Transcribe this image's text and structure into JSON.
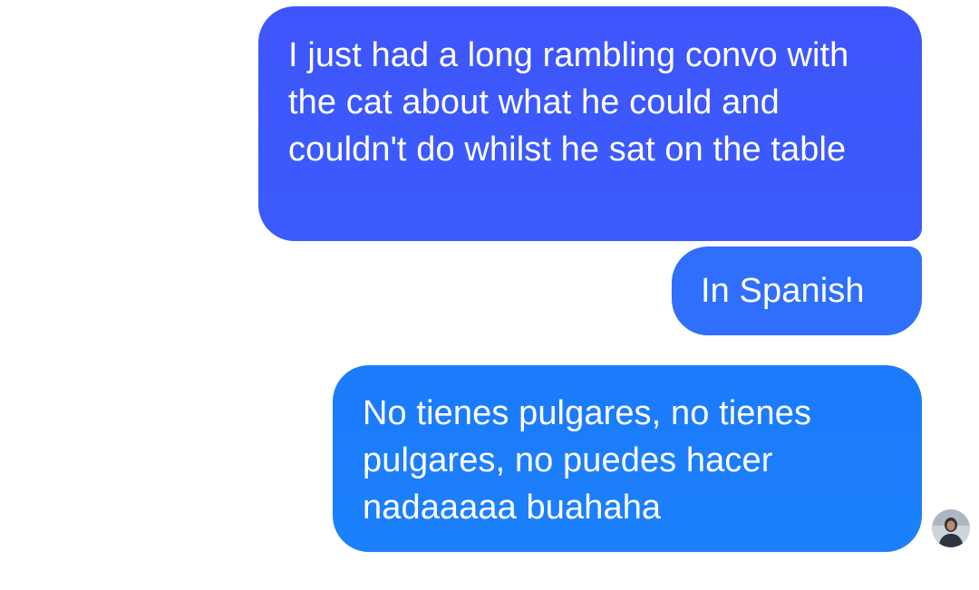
{
  "conversation": {
    "messages": [
      {
        "text": "I just had a long rambling convo with the cat about what he could and couldn't do whilst he sat on the table"
      },
      {
        "text": "In Spanish"
      },
      {
        "text": "No tienes pulgares, no tienes pulgares, no puedes hacer nadaaaaa buahaha"
      }
    ],
    "read_receipt": {
      "icon": "contact-avatar-icon"
    }
  },
  "colors": {
    "bubble_1": "#3d58fb",
    "bubble_2": "#2f6ffc",
    "bubble_3": "#1c7dfb",
    "text": "#ffffff",
    "background": "#ffffff"
  }
}
